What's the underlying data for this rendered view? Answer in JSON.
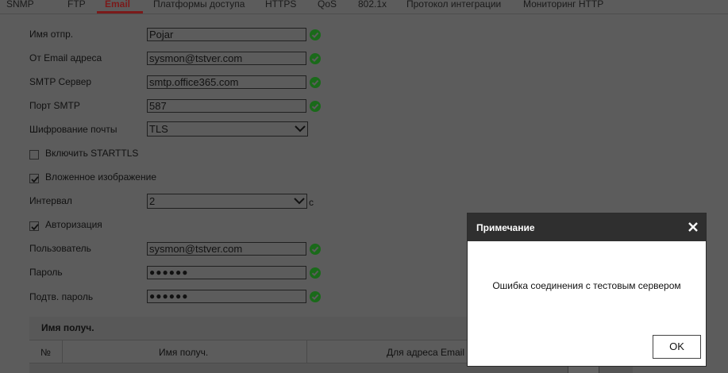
{
  "tabs": [
    "SNMP",
    "FTP",
    "Email",
    "Платформы доступа",
    "HTTPS",
    "QoS",
    "802.1x",
    "Протокол интеграции",
    "Мониторинг HTTP"
  ],
  "form": {
    "sender_name": {
      "label": "Имя отпр.",
      "value": "Pojar"
    },
    "sender_email": {
      "label": "От Email адреса",
      "value": "sysmon@tstver.com"
    },
    "smtp_server": {
      "label": "SMTP Сервер",
      "value": "smtp.office365.com"
    },
    "smtp_port": {
      "label": "Порт SMTP",
      "value": "587"
    },
    "encryption": {
      "label": "Шифрование почты",
      "value": "TLS"
    },
    "starttls": {
      "label": "Включить STARTTLS",
      "checked": false
    },
    "attach_image": {
      "label": "Вложенное изображение",
      "checked": true
    },
    "interval": {
      "label": "Интервал",
      "value": "2",
      "unit": "с"
    },
    "auth": {
      "label": "Авторизация",
      "checked": true
    },
    "user": {
      "label": "Пользователь",
      "value": "sysmon@tstver.com"
    },
    "password": {
      "label": "Пароль",
      "value": "●●●●●●"
    },
    "confirm_password": {
      "label": "Подтв. пароль",
      "value": "●●●●●●"
    }
  },
  "recipients": {
    "title": "Имя получ.",
    "columns": [
      "№",
      "Имя получ.",
      "Для адреса Email"
    ]
  },
  "modal": {
    "title": "Примечание",
    "message": "Ошибка соединения с тестовым сервером",
    "ok_label": "OK"
  },
  "colors": {
    "overlay": "#5c5c5c",
    "active_tab": "#7a1a1a",
    "modal_header": "#2f2f2f",
    "valid_icon": "#1a6a1a"
  }
}
